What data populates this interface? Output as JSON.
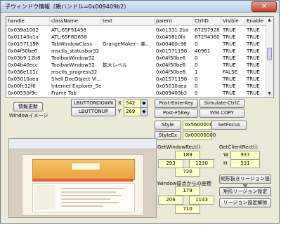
{
  "window": {
    "title": "子ウィンドウ情報（親ハンドル=0x009409b2）",
    "close_icon": "close-icon"
  },
  "table": {
    "columns": [
      "handle",
      "className",
      "text",
      "parent",
      "CtrlID",
      "Visible",
      "Enable"
    ],
    "rows": [
      [
        "0x039a1002",
        "ATL:65F91458",
        "",
        "0x01331 2ba",
        "67297928",
        "TRUE",
        "TRUE"
      ],
      [
        "0x01140a1a",
        "ATL:65F8D658",
        "",
        "0x045810fa",
        "67294360",
        "TRUE",
        "TRUE"
      ],
      [
        "0x01571198",
        "TabWindowClass",
        "OrangeMaker - 楽...",
        "0x00460c96",
        "0",
        "TRUE",
        "TRUE"
      ],
      [
        "0x04f50be6",
        "msctls_statusbar32",
        "",
        "0x01571198",
        "40961",
        "TRUE",
        "TRUE"
      ],
      [
        "0x03b9 12b8",
        "ToolbarWindow32",
        "",
        "0x04f50be6",
        "0",
        "TRUE",
        "TRUE"
      ],
      [
        "0x04b40ecc",
        "ToolbarWindow32",
        "拡大レベル",
        "0x04f50be6",
        "0",
        "TRUE",
        "TRUE"
      ],
      [
        "0x036e111c",
        "msctls_progress32",
        "",
        "0x04f50be6",
        "1",
        "FALSE",
        "TRUE"
      ],
      [
        "0x05010aea",
        "Shell DocObject Vi...",
        "",
        "0x01571198",
        "0",
        "TRUE",
        "TRUE"
      ],
      [
        "0x00fc12f6",
        "Internet Explorer_Se...",
        "",
        "0x05010aea",
        "0",
        "TRUE",
        "TRUE"
      ],
      [
        "0x00550f9c",
        "Frame Tab",
        "",
        "0x009409b2",
        "0",
        "TRUE",
        "TRUE"
      ]
    ]
  },
  "controls": {
    "refresh": "情報更新",
    "window_image_label": "Windowイメージ",
    "lbuttondown": "LBUTTONDOWN",
    "lbuttonup": "LBUTTONUP",
    "x_label": "X",
    "y_label": "Y",
    "x_value": "542",
    "y_value": "269",
    "post_enterkey": "Post-EnterKey",
    "simulate_ctrlc": "Simulate-CtrlC",
    "post_f5key": "Post-F5Key",
    "wm_copy": "WM COPY",
    "style_btn": "Style",
    "style_value": "0x56000000",
    "styleex_btn": "StyleEx",
    "styleex_value": "0x00000000",
    "setfocus": "SetFocus",
    "getwindowrect_label": "GetWindowRect():",
    "getclientrect_label": "GetClientRect():",
    "gwr_top": "189",
    "gwr_left": "293",
    "gwr_right": "1230",
    "gwr_bottom": "720",
    "gcr_w_label": "W",
    "gcr_h_label": "H",
    "gcr_w": "937",
    "gcr_h": "531",
    "origin_label": "Window原点からの座標",
    "org_top": "179",
    "org_left": "206",
    "org_right": "1143",
    "org_bottom": "710",
    "rect_except_region": "矩形抜きリージョン設定",
    "rect_region": "矩形リージョン設定",
    "region_clear": "リージョン設定解除"
  },
  "colors": {
    "input_bg": "#ffffc8",
    "title_grad_top": "#dbe8f7",
    "close_red": "#c4452e"
  }
}
